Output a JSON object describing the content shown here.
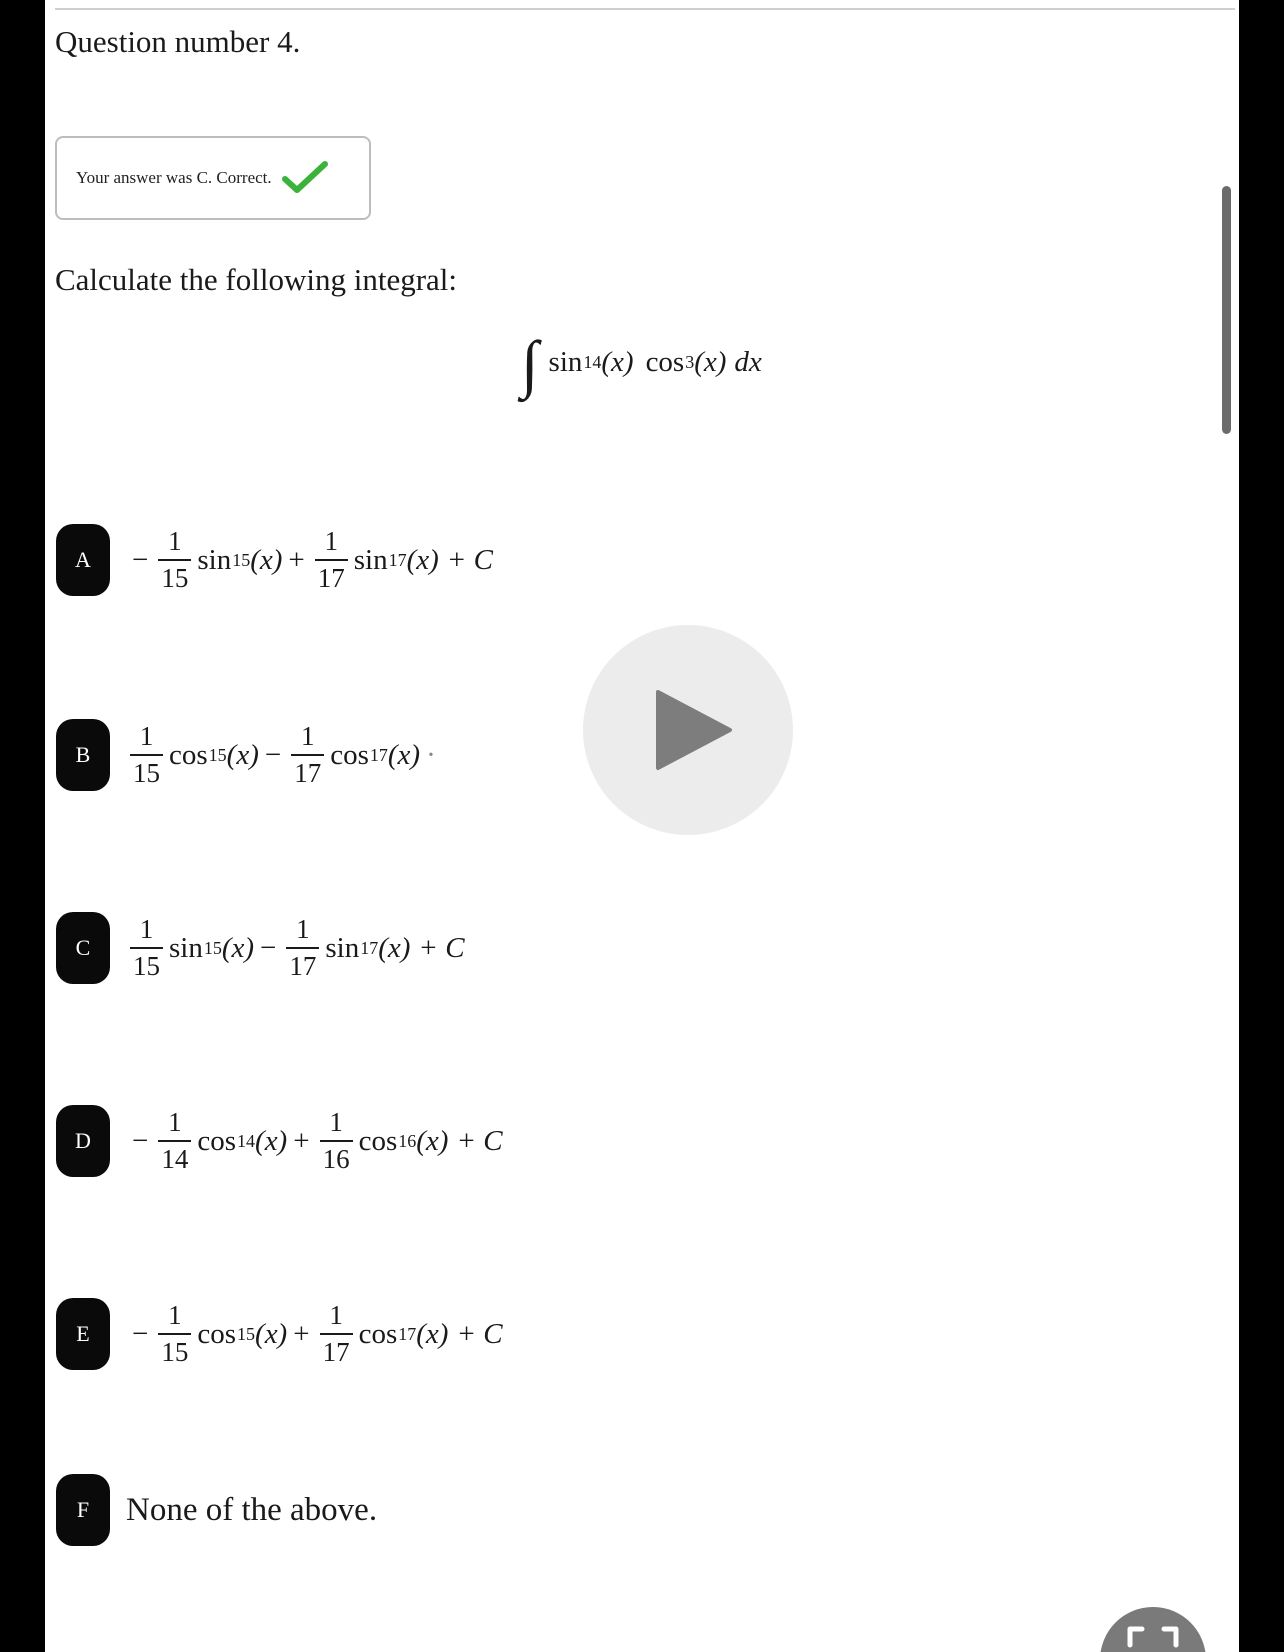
{
  "question": {
    "number_label": "Question number 4.",
    "feedback": "Your answer was C. Correct.",
    "prompt": "Calculate the following integral:",
    "integral": {
      "integral_sign": "∫",
      "f1": "sin",
      "f1_exp": "14",
      "f2": "cos",
      "f2_exp": "3",
      "arg": "(x)",
      "differential": "dx"
    }
  },
  "options": [
    {
      "letter": "A",
      "lead_sign": "−",
      "term1": {
        "num": "1",
        "den": "15",
        "fn": "sin",
        "exp": "15",
        "arg": "(x)"
      },
      "op": "+",
      "term2": {
        "num": "1",
        "den": "17",
        "fn": "sin",
        "exp": "17",
        "arg": "(x)"
      },
      "tail": "+ C"
    },
    {
      "letter": "B",
      "lead_sign": "",
      "term1": {
        "num": "1",
        "den": "15",
        "fn": "cos",
        "exp": "15",
        "arg": "(x)"
      },
      "op": "−",
      "term2": {
        "num": "1",
        "den": "17",
        "fn": "cos",
        "exp": "17",
        "arg": "(x)"
      },
      "tail": "·"
    },
    {
      "letter": "C",
      "lead_sign": "",
      "term1": {
        "num": "1",
        "den": "15",
        "fn": "sin",
        "exp": "15",
        "arg": "(x)"
      },
      "op": "−",
      "term2": {
        "num": "1",
        "den": "17",
        "fn": "sin",
        "exp": "17",
        "arg": "(x)"
      },
      "tail": "+ C"
    },
    {
      "letter": "D",
      "lead_sign": "−",
      "term1": {
        "num": "1",
        "den": "14",
        "fn": "cos",
        "exp": "14",
        "arg": "(x)"
      },
      "op": "+",
      "term2": {
        "num": "1",
        "den": "16",
        "fn": "cos",
        "exp": "16",
        "arg": "(x)"
      },
      "tail": "+ C"
    },
    {
      "letter": "E",
      "lead_sign": "−",
      "term1": {
        "num": "1",
        "den": "15",
        "fn": "cos",
        "exp": "15",
        "arg": "(x)"
      },
      "op": "+",
      "term2": {
        "num": "1",
        "den": "17",
        "fn": "cos",
        "exp": "17",
        "arg": "(x)"
      },
      "tail": "+ C"
    },
    {
      "letter": "F",
      "text": "None of the above."
    }
  ],
  "icons": {
    "check": "check-icon",
    "play": "play-icon",
    "corner": "screenshot-icon"
  },
  "colors": {
    "check_green": "#3bb33b",
    "badge_bg": "#0a0a0a",
    "overlay_bg": "#ebebeb",
    "play_triangle": "#7d7d7d"
  }
}
